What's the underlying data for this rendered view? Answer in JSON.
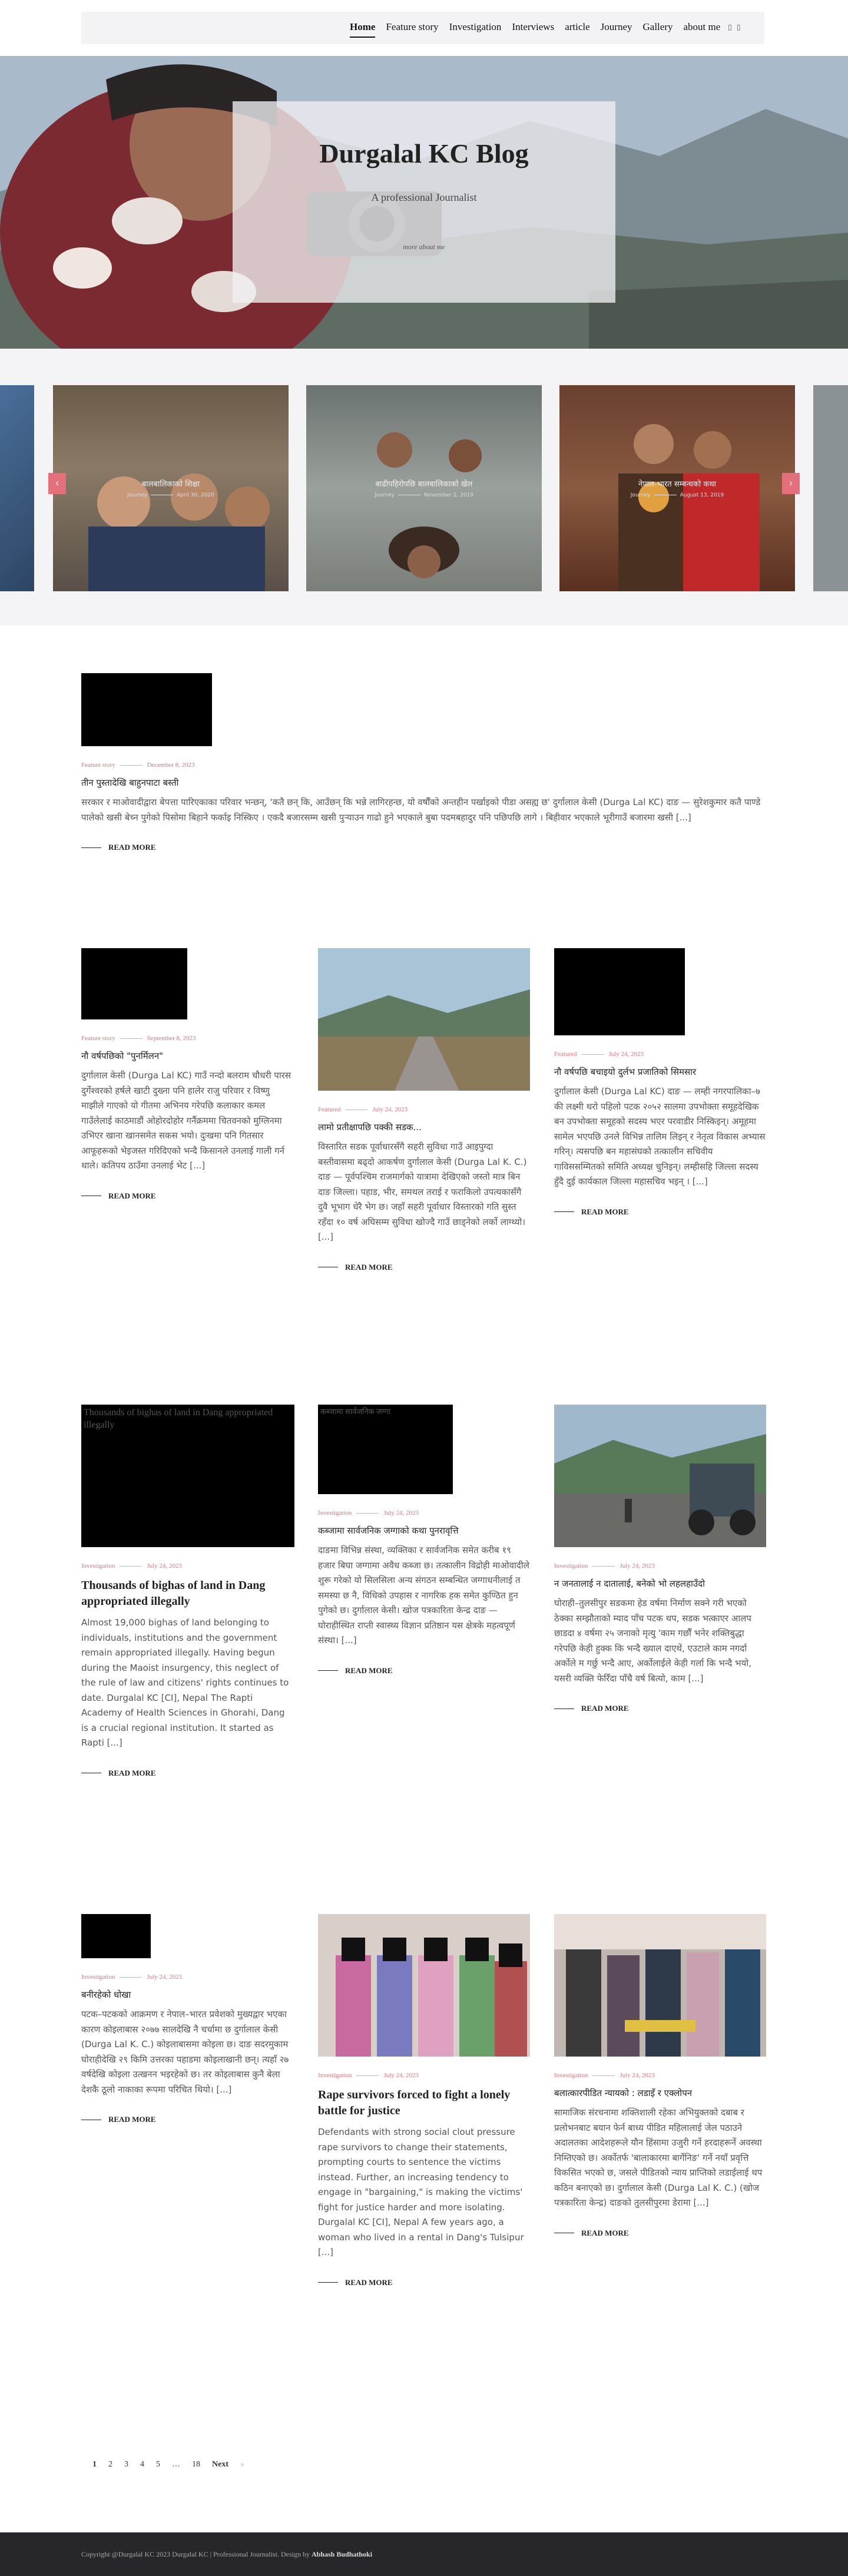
{
  "nav": {
    "items": [
      "Home",
      "Feature story",
      "Investigation",
      "Interviews",
      "article",
      "Journey",
      "Gallery",
      "about me"
    ]
  },
  "hero": {
    "title": "Durgalal KC Blog",
    "subtitle": "A professional Journalist",
    "button": "more about me"
  },
  "carousel": {
    "slides": [
      {
        "title": "बालबालिकाको शिक्षा",
        "category": "Journey",
        "date": "April 30, 2020"
      },
      {
        "title": "बाढीपहिरोपछि बालबालिकाको खेल",
        "category": "Journey",
        "date": "November 2, 2019"
      },
      {
        "title": "नेपाल-भारत सम्बन्धको कथा",
        "category": "Journey",
        "date": "August 13, 2019"
      }
    ]
  },
  "posts": [
    {
      "category": "Feature story",
      "date": "December 8, 2023",
      "title": "तीन पुस्तादेखि बाहुनपाटा बस्ती",
      "excerpt": "सरकार र माओवादीद्वारा बेपत्ता पारिएकाका परिवार भन्छन्, 'कतै छन् कि, आउँछन् कि भन्ने लागिरहन्छ, यो वर्षौंको अन्तहीन पर्खाइको पीडा असह्य छ' दुर्गालाल केसी (Durga Lal KC) दाङ — सुरेशकुमार कतै पाण्डे पालेको खसी बेच्न पुगेको पिसोमा बिहाने फर्काइ निस्किए । एकदै बजारसम्म खसी पुऱ्याउन गाढो हुने भएकाले बुबा पदमबहादुर पनि पछिपछि लागे । बिहीवार भएकाले भूरीगाउँ बजारमा खसी [...]",
      "read_more": "READ MORE",
      "image_alt": ""
    },
    {
      "category": "Feature story",
      "date": "September 8, 2023",
      "title": "नौ वर्षपछिको \"पुनर्मिलन\"",
      "excerpt": "दुर्गालाल केसी (Durga Lal KC) गाउँ नन्दो बलराम चौधरी पारस दुर्गेश्वरको हर्षले खाटी दुख्ना पनि हालेर राजु परिवार र विष्णु माझीले गाएको यो गीतमा अभिनय गरेपछि कलाकार कमल गाउँलेलाई काठमाडौं ओहोरदोहोर गर्नैक्रममा चितवनको मुग्लिनमा उभिएर खाना खानसमेत सकस भयो। दुःखमा पनि गितसार आफूहरूको भेइजस्त गरिदिएको भन्दै किसानले उनलाई गाली गर्न थाले। कतिपय ठाउँमा उनलाई भेट [...]",
      "read_more": "READ MORE",
      "image_alt": ""
    },
    {
      "category": "Featured",
      "date": "July 24, 2023",
      "title": "लामो प्रतीक्षापछि पक्की सडक...",
      "excerpt": "विस्तारित सडक पूर्वाधारसँगै सहरी सुविधा गाउँ आइपुग्दा बस्तीवासमा बढ्दो आकर्षण दुर्गालाल केसी (Durga Lal K. C.) दाङ — पूर्वपश्चिम राजमार्गको यात्रामा देखिएको जस्तो मात्र बिन दाङ जिल्ला। पहाड, भीर, समथल तराई र फराकिलो उपत्यकासँगै दुवै भूभाग धेरै भेग छ। जहाँ सहरी पूर्वाधार विस्तारको गति सुस्त रहँदा १० वर्ष अघिसम्म सुविधा खोज्दै गाउँ छाड्नेको लर्को लाग्थ्यो। [...]",
      "read_more": "READ MORE",
      "image_alt": ""
    },
    {
      "category": "Featured",
      "date": "July 24, 2023",
      "title": "नौ वर्षपछि बचाइयो दुर्लभ प्रजातिको सिमसार",
      "excerpt": "दुर्गालाल केसी (Durga Lal KC) दाङ — लम्ही नगरपालिका–७ की लक्ष्मी थरो पहिलो पटक २०५२ सालमा उपभोक्ता समूहदेखिक बन उपभोक्ता समूहको सदस्य भएर परवाडीर निस्किइन्। अमूहमा सामेल भएपछि उनले विभिन्न तालिम लिइन् र नेतृत्व विकास अभ्यास गरिन्। त्यसपछि बन महासंघको तत्कालीन सचिवीय गाविससम्मितको समिति अध्यक्ष चुनिइन्। लम्हीसहि जिल्ला सदस्य हुँदै दुई कार्यकाल जिल्ला महासचिव भइन् । [...]",
      "read_more": "READ MORE",
      "image_alt": ""
    },
    {
      "category": "Investigation",
      "date": "July 24, 2023",
      "title": "Thousands of bighas of land in Dang appropriated illegally",
      "excerpt": "Almost 19,000 bighas of land belonging to individuals, institutions and the government remain appropriated illegally. Having begun during the Maoist insurgency, this neglect of the rule of law and citizens' rights continues to date. Durgalal KC [CI], Nepal The Rapti Academy of Health Sciences in Ghorahi, Dang is a crucial regional institution. It started as Rapti [...]",
      "read_more": "READ MORE",
      "image_alt": "Thousands of bighas of land in Dang appropriated illegally"
    },
    {
      "category": "Investigation",
      "date": "July 24, 2023",
      "title": "कब्जामा सार्वजनिक जग्गाको कथा पुनरावृत्ति",
      "excerpt": "दाङमा विभिन्न संस्था, व्यक्तिका र सार्वजनिक समेत करीब १९ हजार बिघा जग्गामा अवैध कब्जा छ। तत्कालीन विद्रोही माओवादीले शुरू गरेको यो सिलसिला अन्य संगठन सम्बन्धित जग्गाधनीलाई त समस्या छ नै, विधिको उपहास र नागरिक हक समेत कुण्ठित हुन पुगेको छ। दुर्गालाल केसी। खोज पत्रकारिता केन्द्र दाङ — घोराहीस्थित राप्ती स्वास्थ्य विज्ञान प्रतिष्ठान यस क्षेत्रके महत्वपूर्ण संस्था। [...]",
      "read_more": "READ MORE",
      "image_alt": "कब्जामा सार्वजनिक जग्गा"
    },
    {
      "category": "Investigation",
      "date": "July 24, 2023",
      "title": "न जनतालाई न दातालाई, बनेको भो लहलहाउँदो",
      "excerpt": "घोराही–तुलसीपुर सडकमा हेड वर्षमा निर्माण सक्ने गरी भएको ठेक्का सम्झौताको म्याद पाँच पटक थप, सडक भत्काएर आलप छाडदा ४ वर्षमा २५ जनाको मृत्यु 'काम गर्छौं भनेर शक्तिबुद्धा गरेपछि केही हुक्क कि भन्दै ख्याल दाएथें, एउटाले काम नगर्दा अर्कोले म गर्छु भन्दै आए, अर्कोलाईले केही गर्ला कि भन्दै भयो, यसरी व्यक्ति फेरिँदा पाँचै वर्ष बित्यो, काम [...]",
      "read_more": "READ MORE",
      "image_alt": ""
    },
    {
      "category": "Investigation",
      "date": "July 24, 2023",
      "title": "बनीरहेको धोखा",
      "excerpt": "पटक–पटकको आक्रमण र नेपाल–भारत प्रवेशको मुख्यद्वार भएका कारण कोइलाबास २०७७ सालदेखि नै चर्चामा छ दुर्गालाल केसी (Durga Lal K. C.) कोइलाबासमा कोइला छ। दाङ सदरमुकाम घोराहीदेखि २९ किमि उत्तरका पहाडमा कोइलाखानी छन्। त्यहाँ २७ वर्षदेखि कोइला उत्खनन भइरहेको छ। तर कोइलाबास कुनै बेला देशकै ठूलो नाकाका रूपमा परिचित थियो। [...]",
      "read_more": "READ MORE",
      "image_alt": ""
    },
    {
      "category": "Investigation",
      "date": "July 24, 2023",
      "title": "Rape survivors forced to fight a lonely battle for justice",
      "excerpt": "Defendants with strong social clout pressure rape survivors to change their statements, prompting courts to sentence the victims instead. Further, an increasing tendency to engage in \"bargaining,\" is making the victims' fight for justice harder and more isolating. Durgalal KC [CI], Nepal A few years ago, a woman who lived in a rental in Dang's Tulsipur [...]",
      "read_more": "READ MORE",
      "image_alt": ""
    },
    {
      "category": "Investigation",
      "date": "July 24, 2023",
      "title": "बलात्कारपीडित न्यायको : लडाइँ र एक्लोपन",
      "excerpt": "सामाजिक संरचनामा शक्तिशाली रहेका अभियुक्तको दबाब र प्रलोभनबाट बयान फेर्न बाध्य पीडित महिलालाई जेल पठाउने अदालतका आदेशहरूले यौन हिंसामा उजुरी गर्ने हरदाहरूर्ने अवस्था निम्तिएको छ। अर्कोतर्फ 'बालाकारमा बार्गेनिङ' गर्ने नयाँ प्रवृत्ति विकसित भएको छ, जसले पीडितको न्याय प्राप्तिको लडाईलाई थप कठिन बनाएको छ। दुर्गालाल केसी (Durga Lal K. C.) (खोज पत्रकारिता केन्द्र) दाङको तुलसीपुरमा डेरामा [...]",
      "read_more": "READ MORE",
      "image_alt": ""
    }
  ],
  "pagination": {
    "pages": [
      "1",
      "2",
      "3",
      "4",
      "5",
      "…",
      "18"
    ],
    "next": "Next",
    "arrow": "»"
  },
  "footer": {
    "text": "Copyright @Durgalal KC 2023 Durgalal KC | Professional Journalist. Design by ",
    "author": "Abhash Budhathoki"
  },
  "colors": {
    "accent": "#e0757d",
    "footer_bg": "#27272b",
    "arrow_bg": "#e56f7a"
  }
}
